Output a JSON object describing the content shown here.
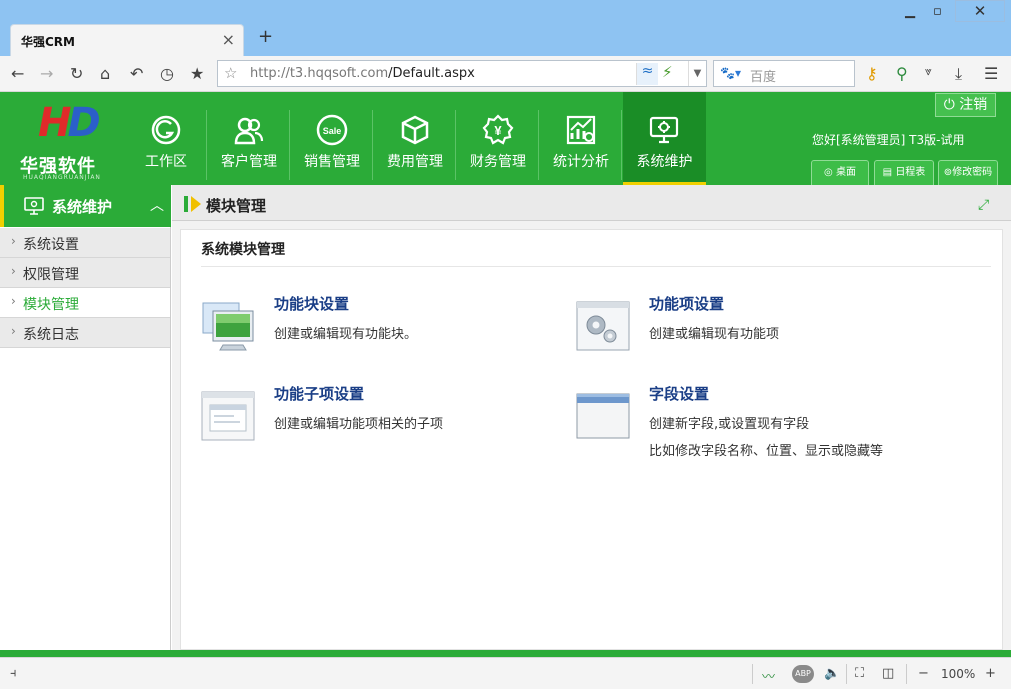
{
  "browser": {
    "tab_title": "华强CRM",
    "tab_close": "×",
    "new_tab": "+",
    "url_host": "http://t3.hqqsoft.com",
    "url_path": "/Default.aspx",
    "search_placeholder": "百度",
    "zoom": "100%",
    "zoom_minus": "−",
    "zoom_plus": "+",
    "abp": "ABP"
  },
  "header": {
    "logo_mark": "HD",
    "logo_text": "华强软件",
    "logo_sub": "HUAQIANGRUANJIAN",
    "logout_label": "注销",
    "welcome": "您好[系统管理员] T3版-试用",
    "buttons": [
      "桌面",
      "日程表",
      "修改密码"
    ],
    "modules": [
      {
        "label": "工作区",
        "icon": "workspace-icon"
      },
      {
        "label": "客户管理",
        "icon": "customers-icon"
      },
      {
        "label": "销售管理",
        "icon": "sale-icon",
        "badge": "Sale"
      },
      {
        "label": "费用管理",
        "icon": "box-icon"
      },
      {
        "label": "财务管理",
        "icon": "finance-icon",
        "badge": "¥"
      },
      {
        "label": "统计分析",
        "icon": "stats-icon"
      },
      {
        "label": "系统维护",
        "icon": "system-icon",
        "active": true
      }
    ]
  },
  "sidebar": {
    "title": "系统维护",
    "items": [
      "系统设置",
      "权限管理",
      "模块管理",
      "系统日志"
    ],
    "active_index": 2
  },
  "content": {
    "title": "模块管理",
    "panel_title": "系统模块管理",
    "cards": [
      {
        "title": "功能块设置",
        "desc": "创建或编辑现有功能块。",
        "desc2": "",
        "icon": "computer-monitor-icon"
      },
      {
        "title": "功能项设置",
        "desc": "创建或编辑现有功能项",
        "desc2": "",
        "icon": "gear-window-icon"
      },
      {
        "title": "功能子项设置",
        "desc": "创建或编辑功能项相关的子项",
        "desc2": "",
        "icon": "sub-window-icon"
      },
      {
        "title": "字段设置",
        "desc": "创建新字段,或设置现有字段",
        "desc2": "比如修改字段名称、位置、显示或隐藏等",
        "icon": "blank-window-icon"
      }
    ]
  },
  "colors": {
    "brand_green": "#2bab38",
    "active_green": "#1a8d26",
    "accent_yellow": "#f0d000",
    "title_blue": "#1a3e86"
  }
}
